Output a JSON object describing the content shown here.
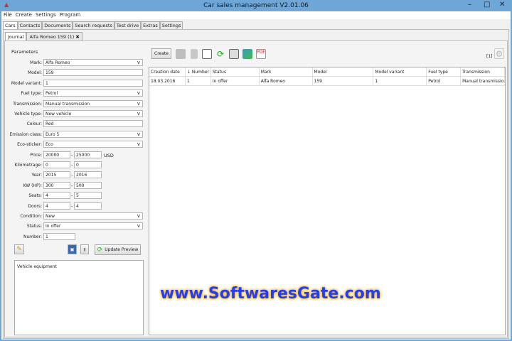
{
  "window": {
    "title": "Car sales management V2.01.06"
  },
  "menu": [
    "File",
    "Create",
    "Settings",
    "Program"
  ],
  "tabs": [
    "Cars",
    "Contacts",
    "Documents",
    "Search requests",
    "Test drive",
    "Extras",
    "Settings"
  ],
  "subtabs": [
    "Journal",
    "Alfa Romeo 159 (1)"
  ],
  "params": {
    "title": "Parameters",
    "fields": [
      {
        "label": "Mark:",
        "value": "Alfa Romeo",
        "type": "select"
      },
      {
        "label": "Model:",
        "value": "159",
        "type": "text"
      },
      {
        "label": "Model variant:",
        "value": "1",
        "type": "text"
      },
      {
        "label": "Fuel type:",
        "value": "Petrol",
        "type": "select"
      },
      {
        "label": "Transmission:",
        "value": "Manual transmission",
        "type": "select"
      },
      {
        "label": "Vehicle type:",
        "value": "New vehicle",
        "type": "select"
      },
      {
        "label": "Colour:",
        "value": "Red",
        "type": "text"
      },
      {
        "label": "Emission class:",
        "value": "Euro 5",
        "type": "select"
      },
      {
        "label": "Eco-sticker:",
        "value": "Eco",
        "type": "select"
      }
    ],
    "ranges": [
      {
        "label": "Price:",
        "from": "20000",
        "to": "25000",
        "unit": "USD"
      },
      {
        "label": "Kilometrage:",
        "from": "0",
        "to": "0"
      },
      {
        "label": "Year:",
        "from": "2015",
        "to": "2016"
      },
      {
        "label": "KW (HP):",
        "from": "300",
        "to": "500"
      },
      {
        "label": "Seats:",
        "from": "4",
        "to": "5"
      },
      {
        "label": "Doors:",
        "from": "4",
        "to": "4"
      }
    ],
    "fields2": [
      {
        "label": "Condition:",
        "value": "New",
        "type": "select"
      },
      {
        "label": "Status:",
        "value": "In offer",
        "type": "select"
      }
    ],
    "number": {
      "label": "Number:",
      "value": "1"
    },
    "update_preview": "Update Preview",
    "equipment": "Vehicle equipment"
  },
  "toolbar": {
    "create": "Create",
    "count": "[1]"
  },
  "table": {
    "columns": [
      "Creation date",
      "↓ Number",
      "Status",
      "Mark",
      "Model",
      "Model variant",
      "Fuel type",
      "Transmission"
    ],
    "rows": [
      [
        "18.03.2016",
        "1",
        "In offer",
        "Alfa Romeo",
        "159",
        "1",
        "Petrol",
        "Manual transmission"
      ]
    ]
  },
  "watermark": "www.SoftwaresGate.com"
}
